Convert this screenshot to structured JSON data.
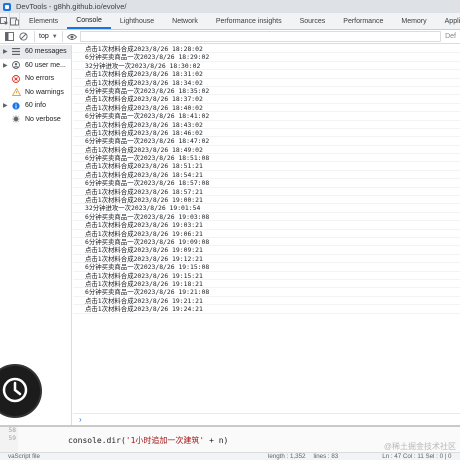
{
  "window": {
    "title": "DevTools - g8hh.github.io/evolve/"
  },
  "tabs": [
    {
      "label": "Elements",
      "active": false
    },
    {
      "label": "Console",
      "active": true
    },
    {
      "label": "Lighthouse",
      "active": false
    },
    {
      "label": "Network",
      "active": false
    },
    {
      "label": "Performance insights",
      "active": false
    },
    {
      "label": "Sources",
      "active": false
    },
    {
      "label": "Performance",
      "active": false
    },
    {
      "label": "Memory",
      "active": false
    },
    {
      "label": "Application",
      "active": false
    }
  ],
  "toolbar": {
    "context": "top",
    "filter_placeholder": "",
    "levels": "Def"
  },
  "sidebar": {
    "items": [
      {
        "label": "60 messages",
        "icon": "list-icon",
        "selected": true
      },
      {
        "label": "60 user me...",
        "icon": "user-icon",
        "selected": false
      },
      {
        "label": "No errors",
        "icon": "error-icon",
        "selected": false
      },
      {
        "label": "No warnings",
        "icon": "warning-icon",
        "selected": false
      },
      {
        "label": "60 info",
        "icon": "info-icon",
        "selected": false
      },
      {
        "label": "No verbose",
        "icon": "verbose-icon",
        "selected": false
      }
    ]
  },
  "console": {
    "lines": [
      "点击1次材料合成2023/8/26 18:28:02",
      "6分钟买卖商品一次2023/8/26 18:29:02",
      "32分钟进攻一次2023/8/26 18:30:02",
      "点击1次材料合成2023/8/26 18:31:02",
      "点击1次材料合成2023/8/26 18:34:02",
      "6分钟买卖商品一次2023/8/26 18:35:02",
      "点击1次材料合成2023/8/26 18:37:02",
      "点击1次材料合成2023/8/26 18:40:02",
      "6分钟买卖商品一次2023/8/26 18:41:02",
      "点击1次材料合成2023/8/26 18:43:02",
      "点击1次材料合成2023/8/26 18:46:02",
      "6分钟买卖商品一次2023/8/26 18:47:02",
      "点击1次材料合成2023/8/26 18:49:02",
      "6分钟买卖商品一次2023/8/26 18:51:08",
      "点击1次材料合成2023/8/26 18:51:21",
      "点击1次材料合成2023/8/26 18:54:21",
      "6分钟买卖商品一次2023/8/26 18:57:08",
      "点击1次材料合成2023/8/26 18:57:21",
      "点击1次材料合成2023/8/26 19:00:21",
      "32分钟进攻一次2023/8/26 19:01:54",
      "6分钟买卖商品一次2023/8/26 19:03:08",
      "点击1次材料合成2023/8/26 19:03:21",
      "点击1次材料合成2023/8/26 19:06:21",
      "6分钟买卖商品一次2023/8/26 19:09:08",
      "点击1次材料合成2023/8/26 19:09:21",
      "点击1次材料合成2023/8/26 19:12:21",
      "6分钟买卖商品一次2023/8/26 19:15:08",
      "点击1次材料合成2023/8/26 19:15:21",
      "点击1次材料合成2023/8/26 19:18:21",
      "6分钟买卖商品一次2023/8/26 19:21:08",
      "点击1次材料合成2023/8/26 19:21:21",
      "点击1次材料合成2023/8/26 19:24:21"
    ]
  },
  "editor": {
    "gutter": [
      "58",
      "59"
    ],
    "code_prefix": "console.dir(",
    "code_string": "'1小时追加一次建筑'",
    "code_suffix": " + n)",
    "watermark": "@稀土掘金技术社区"
  },
  "statusbar": {
    "file": "vaScript file",
    "length": "length : 1,352",
    "lines": "lines : 83",
    "position": "Ln : 47   Col : 11   Sel : 0 | 0"
  },
  "colors": {
    "accent": "#1a73e8",
    "error": "#d93025",
    "warning": "#e8a33d",
    "info": "#1a73e8"
  }
}
